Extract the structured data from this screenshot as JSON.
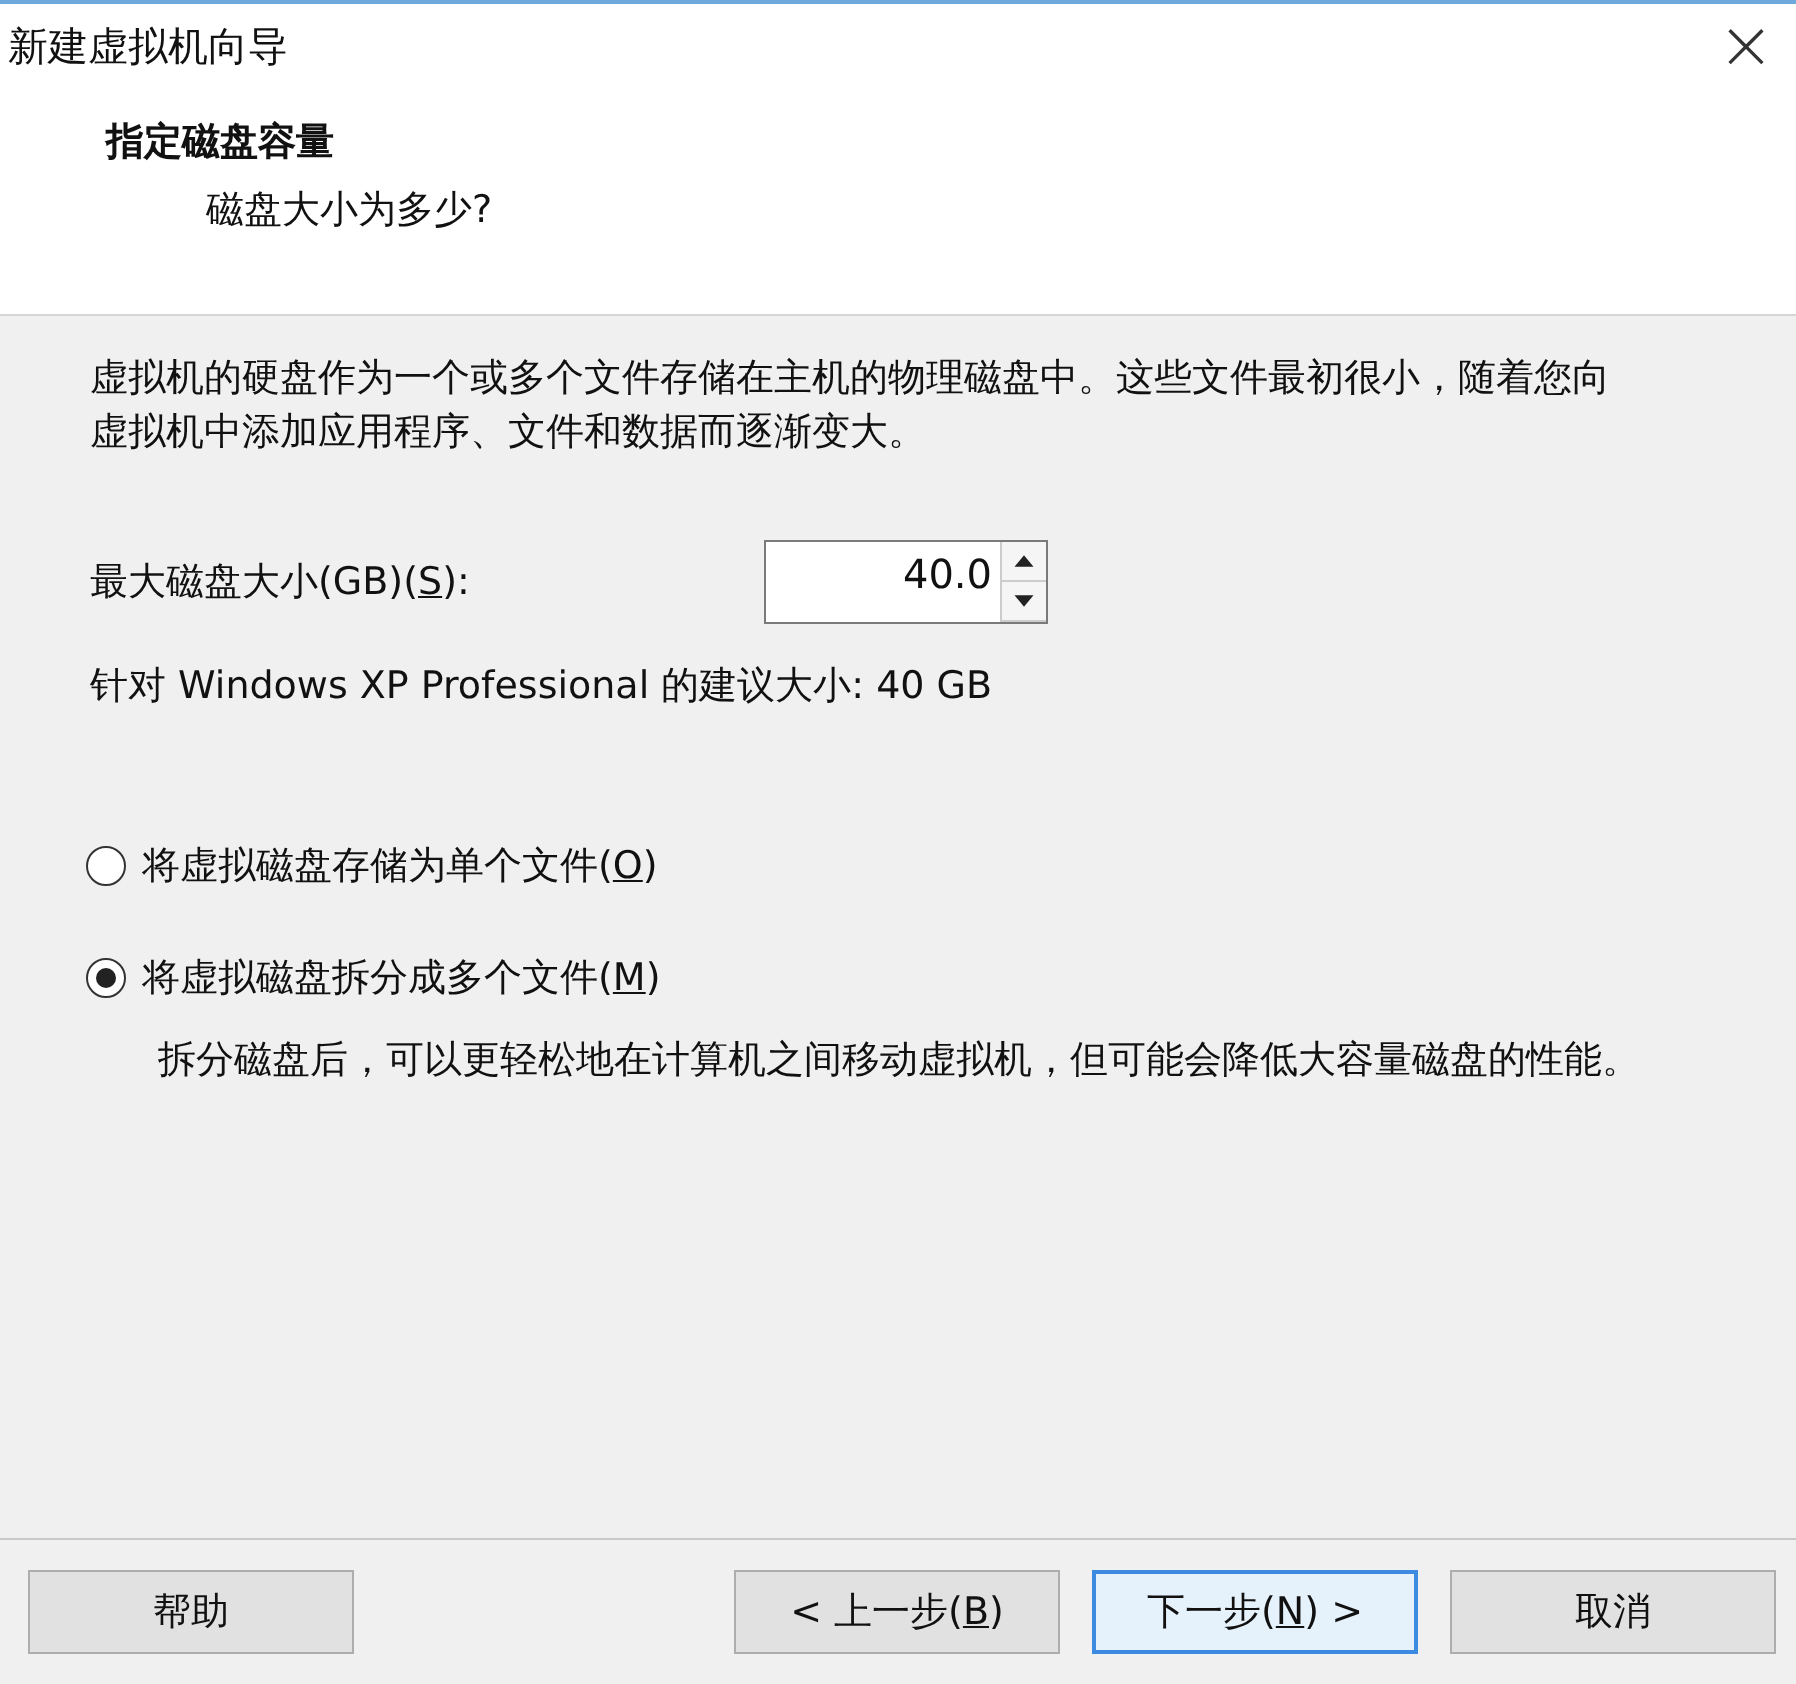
{
  "window": {
    "title": "新建虚拟机向导",
    "close": "×"
  },
  "header": {
    "title": "指定磁盘容量",
    "subtitle": "磁盘大小为多少?"
  },
  "intro": "虚拟机的硬盘作为一个或多个文件存储在主机的物理磁盘中。这些文件最初很小，随着您向虚拟机中添加应用程序、文件和数据而逐渐变大。",
  "disk_size": {
    "before": "最大磁盘大小(GB)(",
    "key": "S",
    "after": "):",
    "value": "40.0"
  },
  "recommendation": "针对 Windows XP Professional 的建议大小: 40 GB",
  "options": [
    {
      "before": "将虚拟磁盘存储为单个文件(",
      "key": "O",
      "after": ")",
      "selected": false
    },
    {
      "before": "将虚拟磁盘拆分成多个文件(",
      "key": "M",
      "after": ")",
      "selected": true,
      "note": "拆分磁盘后，可以更轻松地在计算机之间移动虚拟机，但可能会降低大容量磁盘的性能。"
    }
  ],
  "buttons": [
    {
      "label": "帮助",
      "default": false
    },
    {
      "before": "< 上一步(",
      "key": "B",
      "after": ")",
      "default": false
    },
    {
      "before": "下一步(",
      "key": "N",
      "after": ") >",
      "default": true
    },
    {
      "label": "取消",
      "default": false
    }
  ]
}
